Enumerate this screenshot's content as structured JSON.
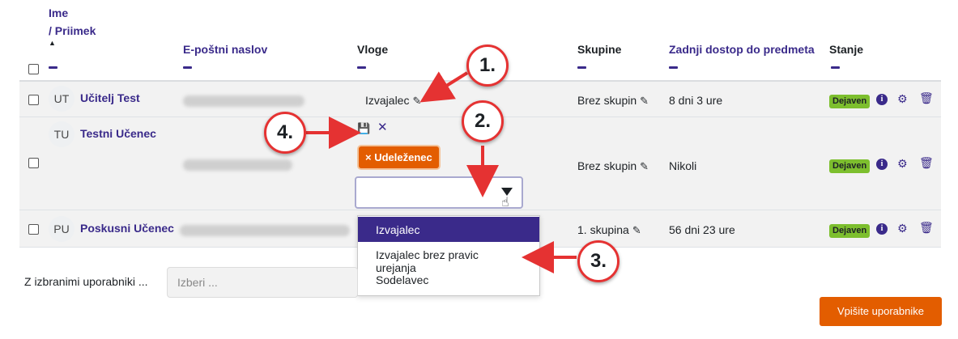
{
  "header": {
    "name_label": "Ime",
    "surname_label": "/ Priimek",
    "sort_arrow": "▲",
    "email_label": "E-poštni naslov",
    "roles_label": "Vloge",
    "groups_label": "Skupine",
    "last_access_label": "Zadnji dostop do predmeta",
    "status_label": "Stanje"
  },
  "rows": [
    {
      "initials": "UT",
      "name": "Učitelj Test",
      "role": "Izvajalec",
      "group": "Brez skupin",
      "last_access": "8 dni 3 ure",
      "status": "Dejaven"
    },
    {
      "initials": "TU",
      "name": "Testni Učenec",
      "group": "Brez skupin",
      "last_access": "Nikoli",
      "status": "Dejaven"
    },
    {
      "initials": "PU",
      "name": "Poskusni Učenec",
      "group": "1. skupina",
      "last_access": "56 dni 23 ure",
      "status": "Dejaven"
    }
  ],
  "role_editor": {
    "assigned_tag": "× Udeleženec",
    "options": [
      "Izvajalec",
      "Izvajalec brez pravic urejanja",
      "Sodelavec"
    ],
    "selected_option": "Izvajalec"
  },
  "bulk": {
    "label": "Z izbranimi uporabniki ...",
    "placeholder": "Izberi ..."
  },
  "enrol_button": "Vpišite uporabnike",
  "callouts": [
    "1.",
    "2.",
    "3.",
    "4."
  ],
  "icons": {
    "edit": "pencil-icon",
    "info": "info-icon",
    "settings": "gear-icon",
    "delete": "trash-icon",
    "save": "save-icon",
    "cancel": "close-icon"
  },
  "colors": {
    "accent": "#3a2a8a",
    "orange": "#e35d00",
    "status_green": "#7dbf2e",
    "callout_red": "#e53232"
  }
}
